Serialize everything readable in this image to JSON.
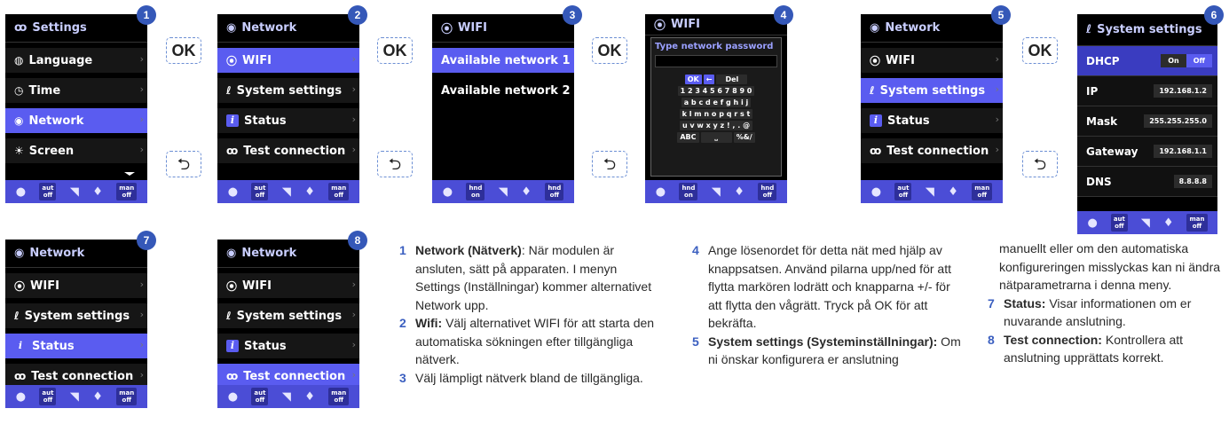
{
  "buttons": {
    "ok": "OK",
    "back": "⮌"
  },
  "status_bar": {
    "aut_off": [
      "aut",
      "off"
    ],
    "man_off": [
      "man",
      "off"
    ],
    "hnd_on": [
      "hnd",
      "on"
    ],
    "hnd_off": [
      "hnd",
      "off"
    ]
  },
  "screens": [
    {
      "badge": "1",
      "title": "Settings",
      "items": [
        "Language",
        "Time",
        "Network",
        "Screen"
      ]
    },
    {
      "badge": "2",
      "title": "Network",
      "items": [
        "WIFI",
        "System settings",
        "Status",
        "Test connection"
      ]
    },
    {
      "badge": "3",
      "title": "WIFI",
      "items": [
        "Available network 1",
        "Available network 2"
      ]
    },
    {
      "badge": "4",
      "title": "WIFI",
      "kb_title": "Type network password",
      "kb_keys": [
        "OK",
        "←",
        "Del"
      ],
      "kb_rows": [
        "1 2 3 4 5 6 7 8 9 0",
        "a b c d e f g h i j",
        "k l m n o p q r s t",
        "u v w x y z ! , . @"
      ],
      "kb_bottom": [
        "ABC",
        "⎵",
        "%&/"
      ]
    },
    {
      "badge": "5",
      "title": "Network",
      "items": [
        "WIFI",
        "System settings",
        "Status",
        "Test connection"
      ]
    },
    {
      "badge": "6",
      "title": "System settings",
      "rows": [
        {
          "label": "DHCP",
          "on": "On",
          "off": "Off"
        },
        {
          "label": "IP",
          "value": "192.168.1.2"
        },
        {
          "label": "Mask",
          "value": "255.255.255.0"
        },
        {
          "label": "Gateway",
          "value": "192.168.1.1"
        },
        {
          "label": "DNS",
          "value": "8.8.8.8"
        }
      ]
    },
    {
      "badge": "7",
      "title": "Network",
      "items": [
        "WIFI",
        "System settings",
        "Status",
        "Test connection"
      ]
    },
    {
      "badge": "8",
      "title": "Network",
      "items": [
        "WIFI",
        "System settings",
        "Status",
        "Test connection"
      ]
    }
  ],
  "desc1": [
    {
      "n": "1",
      "b": "Network (Nätverk)",
      "t": ": När modulen är ansluten, sätt på apparaten. I menyn Settings (Inställningar) kommer alternativet Network upp."
    },
    {
      "n": "2",
      "b": "Wifi:",
      "t": " Välj alternativet WIFI för att starta den automatiska sökningen efter tillgängliga nätverk."
    },
    {
      "n": "3",
      "b": "",
      "t": "Välj lämpligt nätverk bland de tillgängliga."
    }
  ],
  "desc2": [
    {
      "n": "4",
      "b": "",
      "t": "Ange lösenordet för detta nät med hjälp av knappsatsen. Använd pilarna upp/ned för att flytta markören lodrätt och knapparna +/- för att flytta den vågrätt. Tryck på OK för att bekräfta."
    },
    {
      "n": "5",
      "b": "System settings (Systeminställningar):",
      "t": " Om ni önskar konfigurera er anslutning"
    }
  ],
  "desc3_cont": "manuellt eller om den automatiska konfigureringen misslyckas kan ni ändra nätparametrarna i denna meny.",
  "desc3": [
    {
      "n": "7",
      "b": "Status:",
      "t": " Visar informationen om er nuvarande anslutning."
    },
    {
      "n": "8",
      "b": "Test connection:",
      "t": " Kontrollera att anslutning upprättats korrekt."
    }
  ]
}
